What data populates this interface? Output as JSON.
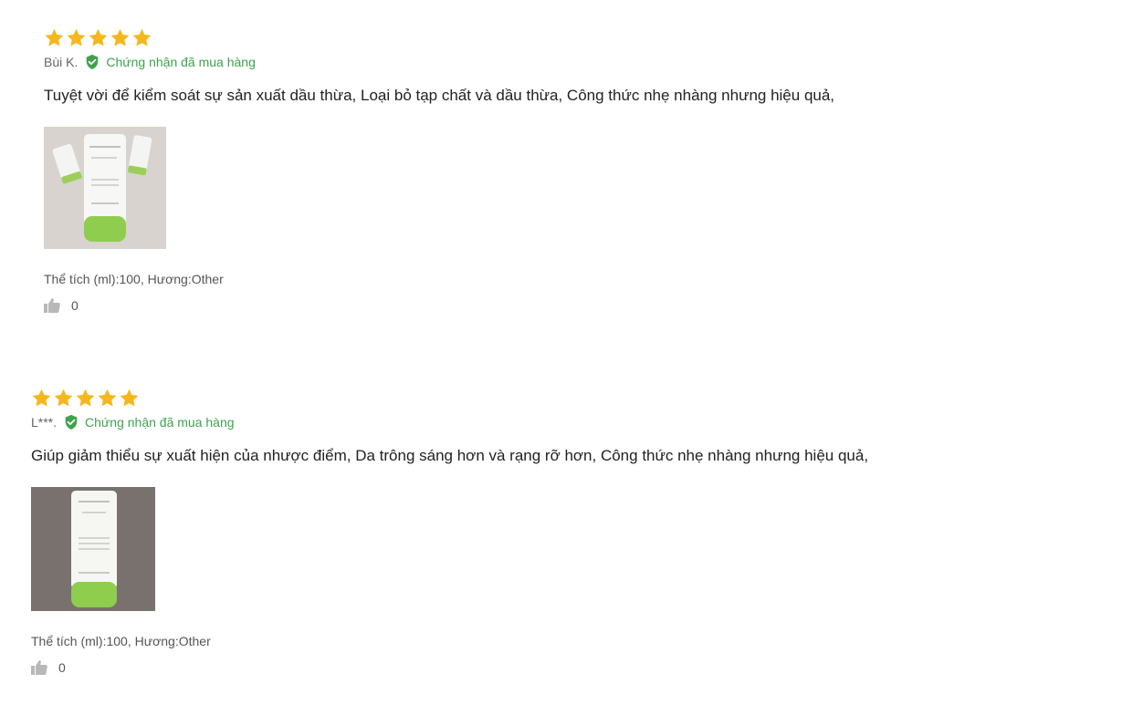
{
  "reviews": [
    {
      "rating": 5,
      "reviewer": "Bùi K.",
      "verified_label": "Chứng nhận đã mua hàng",
      "text": "Tuyệt vời để kiểm soát sự sản xuất dầu thừa, Loại bỏ tạp chất và dầu thừa, Công thức nhẹ nhàng nhưng hiệu quả,",
      "attributes": "Thể tích (ml):100, Hương:Other",
      "likes": "0"
    },
    {
      "rating": 5,
      "reviewer": "L***.",
      "verified_label": "Chứng nhận đã mua hàng",
      "text": "Giúp giảm thiểu sự xuất hiện của nhược điểm, Da trông sáng hơn và rạng rỡ hơn, Công thức nhẹ nhàng nhưng hiệu quả,",
      "attributes": "Thể tích (ml):100, Hương:Other",
      "likes": "0"
    }
  ],
  "colors": {
    "star": "#f5b81c",
    "verified": "#3fa34d",
    "like_icon": "#b8b8b8"
  },
  "icons": {
    "star": "star-icon",
    "verified": "verified-check-icon",
    "like": "thumbs-up-icon"
  }
}
